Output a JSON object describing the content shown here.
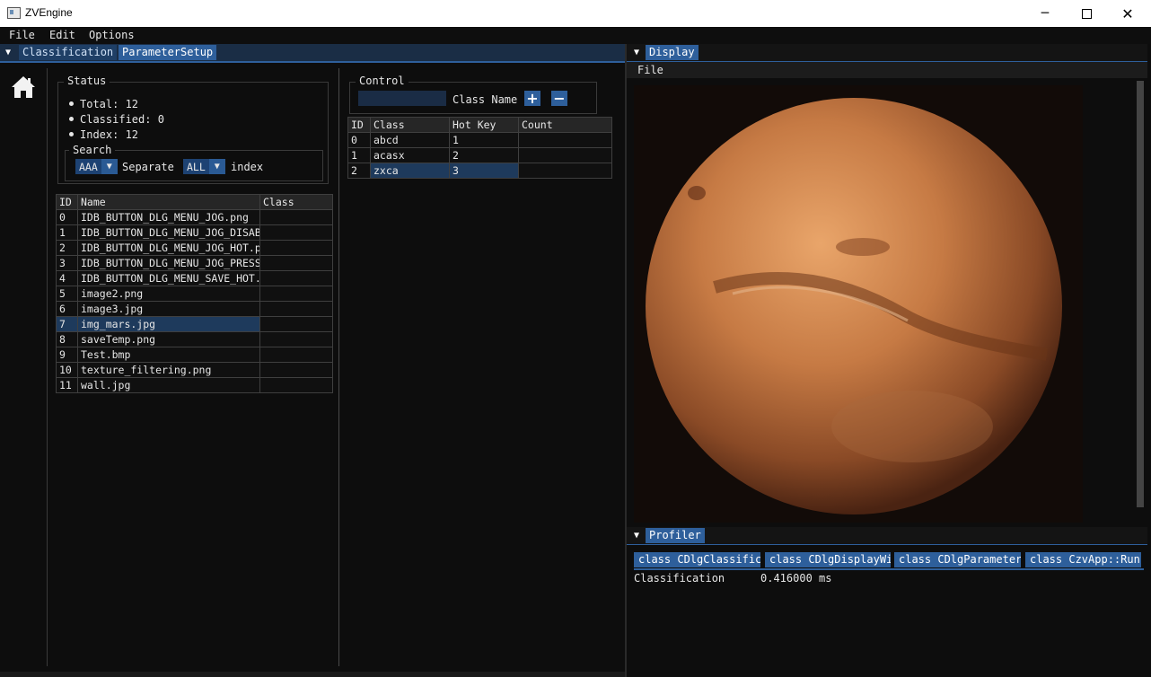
{
  "window": {
    "title": "ZVEngine"
  },
  "menu": {
    "file": "File",
    "edit": "Edit",
    "options": "Options"
  },
  "left_tabs": {
    "classification": "Classification",
    "parameter_setup": "ParameterSetup"
  },
  "status": {
    "title": "Status",
    "total": "Total: 12",
    "classified": "Classified: 0",
    "index": "Index: 12",
    "search_title": "Search",
    "combo1": "AAA",
    "separate": "Separate",
    "combo2": "ALL",
    "index_label": "index"
  },
  "file_table": {
    "headers": [
      "ID",
      "Name",
      "Class"
    ],
    "rows": [
      {
        "id": "0",
        "name": "IDB_BUTTON_DLG_MENU_JOG.png",
        "cls": ""
      },
      {
        "id": "1",
        "name": "IDB_BUTTON_DLG_MENU_JOG_DISABLE.png",
        "cls": ""
      },
      {
        "id": "2",
        "name": "IDB_BUTTON_DLG_MENU_JOG_HOT.png",
        "cls": ""
      },
      {
        "id": "3",
        "name": "IDB_BUTTON_DLG_MENU_JOG_PRESS.png",
        "cls": ""
      },
      {
        "id": "4",
        "name": "IDB_BUTTON_DLG_MENU_SAVE_HOT.png",
        "cls": ""
      },
      {
        "id": "5",
        "name": "image2.png",
        "cls": ""
      },
      {
        "id": "6",
        "name": "image3.jpg",
        "cls": ""
      },
      {
        "id": "7",
        "name": "img_mars.jpg",
        "cls": ""
      },
      {
        "id": "8",
        "name": "saveTemp.png",
        "cls": ""
      },
      {
        "id": "9",
        "name": "Test.bmp",
        "cls": ""
      },
      {
        "id": "10",
        "name": "texture_filtering.png",
        "cls": ""
      },
      {
        "id": "11",
        "name": "wall.jpg",
        "cls": ""
      }
    ],
    "selected_index": 7
  },
  "control": {
    "title": "Control",
    "class_name_value": "",
    "class_name_label": "Class Name",
    "add": "+",
    "remove": "−"
  },
  "class_table": {
    "headers": [
      "ID",
      "Class",
      "Hot Key",
      "Count"
    ],
    "rows": [
      {
        "id": "0",
        "cls": "abcd",
        "key": "1",
        "count": ""
      },
      {
        "id": "1",
        "cls": "acasx",
        "key": "2",
        "count": ""
      },
      {
        "id": "2",
        "cls": "zxca",
        "key": "3",
        "count": ""
      }
    ],
    "selected_index": 2
  },
  "display": {
    "tab": "Display",
    "menu_file": "File"
  },
  "profiler": {
    "tab": "Profiler",
    "tabs": [
      "class CDlgClassification",
      "class CDlgDisplayWindow",
      "class CDlgParameterSetup",
      "class CzvApp::Run"
    ],
    "row_label": "Classification",
    "row_value": "0.416000 ms"
  },
  "colors": {
    "accent": "#2e5f9b",
    "accent_dark": "#1f3f66",
    "selection": "#1e3a5c",
    "background": "#0d0d0d"
  }
}
